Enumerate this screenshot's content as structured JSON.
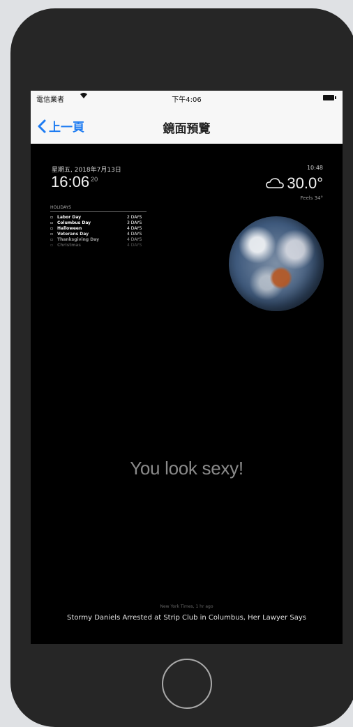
{
  "status_bar": {
    "carrier": "電信業者",
    "wifi_icon": "wifi-icon",
    "time": "下午4:06",
    "battery_icon": "battery-icon"
  },
  "nav": {
    "back_label": "上一頁",
    "title": "鏡面預覽"
  },
  "mirror": {
    "date": "星期五, 2018年7月13日",
    "time": "16:06",
    "seconds": "20",
    "holidays_title": "HOLIDAYS",
    "holidays": [
      {
        "name": "Labor Day",
        "date": "2 DAYS",
        "opacity": 1.0
      },
      {
        "name": "Columbus Day",
        "date": "3 DAYS",
        "opacity": 1.0
      },
      {
        "name": "Halloween",
        "date": "4 DAYS",
        "opacity": 1.0
      },
      {
        "name": "Veterans Day",
        "date": "4 DAYS",
        "opacity": 0.9
      },
      {
        "name": "Thanksgiving Day",
        "date": "4 DAYS",
        "opacity": 0.6
      },
      {
        "name": "Christmas",
        "date": "4 DAYS",
        "opacity": 0.3
      }
    ],
    "weather_top": "10:48",
    "temperature": "30.0°",
    "feels_like": "Feels 34°",
    "compliment": "You look sexy!",
    "news_source": "New York Times, 1 hr ago",
    "news_headline": "Stormy Daniels Arrested at Strip Club in Columbus, Her Lawyer Says"
  }
}
